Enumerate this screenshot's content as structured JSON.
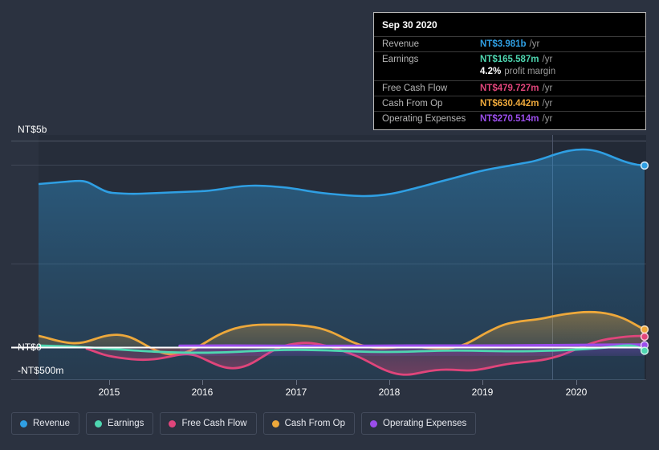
{
  "background_color": "#2b3240",
  "axis": {
    "y_top_label": "NT$5b",
    "y_zero_label": "NT$0",
    "y_bottom_label": "-NT$500m",
    "x_tick_labels": [
      "2015",
      "2016",
      "2017",
      "2018",
      "2019",
      "2020"
    ]
  },
  "tooltip": {
    "date": "Sep 30 2020",
    "rows": [
      {
        "key": "Revenue",
        "value": "NT$3.981b",
        "unit": "/yr",
        "color": "#2f9fe3"
      },
      {
        "key": "Earnings",
        "value": "NT$165.587m",
        "unit": "/yr",
        "color": "#4ed6b0"
      },
      {
        "key": "",
        "value": "4.2%",
        "unit": "profit margin",
        "color": "#ffffff"
      },
      {
        "key": "Free Cash Flow",
        "value": "NT$479.727m",
        "unit": "/yr",
        "color": "#e0457b"
      },
      {
        "key": "Cash From Op",
        "value": "NT$630.442m",
        "unit": "/yr",
        "color": "#eda83b"
      },
      {
        "key": "Operating Expenses",
        "value": "NT$270.514m",
        "unit": "/yr",
        "color": "#9b4deb"
      }
    ]
  },
  "legend": [
    {
      "label": "Revenue",
      "color": "#2f9fe3"
    },
    {
      "label": "Earnings",
      "color": "#4ed6b0"
    },
    {
      "label": "Free Cash Flow",
      "color": "#e0457b"
    },
    {
      "label": "Cash From Op",
      "color": "#eda83b"
    },
    {
      "label": "Operating Expenses",
      "color": "#9b4deb"
    }
  ],
  "chart_data": {
    "type": "line",
    "title": "",
    "xlabel": "",
    "ylabel": "",
    "currency": "NT$",
    "grid": true,
    "legend_position": "bottom",
    "ylim": [
      -500000000,
      5000000000
    ],
    "y_ticks": [
      {
        "label": "NT$5b",
        "value": 5000000000
      },
      {
        "label": "NT$0",
        "value": 0
      },
      {
        "label": "-NT$500m",
        "value": -500000000
      }
    ],
    "x_ticks": [
      "2015",
      "2016",
      "2017",
      "2018",
      "2019",
      "2020"
    ],
    "x_range": [
      "2014-06",
      "2020-12"
    ],
    "forecast_boundary": "2019-11",
    "series": [
      {
        "name": "Revenue",
        "color": "#2f9fe3",
        "filled": true,
        "unit": "NT$",
        "x": [
          "2014-06",
          "2014-09",
          "2014-12",
          "2015-03",
          "2015-06",
          "2015-09",
          "2015-12",
          "2016-03",
          "2016-06",
          "2016-09",
          "2016-12",
          "2017-03",
          "2017-06",
          "2017-09",
          "2017-12",
          "2018-03",
          "2018-06",
          "2018-09",
          "2018-12",
          "2019-03",
          "2019-06",
          "2019-09",
          "2019-12",
          "2020-03",
          "2020-06",
          "2020-09"
        ],
        "values": [
          3.42,
          3.44,
          3.46,
          3.3,
          3.23,
          3.21,
          3.22,
          3.24,
          3.22,
          3.18,
          3.12,
          3.1,
          3.06,
          3.07,
          3.11,
          3.15,
          3.22,
          3.3,
          3.38,
          3.46,
          3.57,
          3.69,
          3.83,
          3.93,
          4.02,
          3.981
        ],
        "value_unit": "billions"
      },
      {
        "name": "Earnings",
        "color": "#4ed6b0",
        "unit": "NT$",
        "x": [
          "2014-06",
          "2014-09",
          "2014-12",
          "2015-03",
          "2015-06",
          "2015-09",
          "2015-12",
          "2016-03",
          "2016-06",
          "2016-09",
          "2016-12",
          "2017-03",
          "2017-06",
          "2017-09",
          "2017-12",
          "2018-03",
          "2018-06",
          "2018-09",
          "2018-12",
          "2019-03",
          "2019-06",
          "2019-09",
          "2019-12",
          "2020-03",
          "2020-06",
          "2020-09"
        ],
        "values": [
          18,
          14,
          10,
          2,
          -8,
          -18,
          -28,
          -38,
          -46,
          -52,
          -50,
          -42,
          -30,
          -18,
          -8,
          -2,
          2,
          0,
          -6,
          -14,
          -18,
          -10,
          10,
          60,
          120,
          165.587
        ],
        "value_unit": "millions"
      },
      {
        "name": "Free Cash Flow",
        "color": "#e0457b",
        "filled": true,
        "unit": "NT$",
        "x": [
          "2014-12",
          "2015-03",
          "2015-06",
          "2015-09",
          "2015-12",
          "2016-03",
          "2016-06",
          "2016-09",
          "2016-12",
          "2017-03",
          "2017-06",
          "2017-09",
          "2017-12",
          "2018-03",
          "2018-06",
          "2018-09",
          "2018-12",
          "2019-03",
          "2019-06",
          "2019-09",
          "2019-12",
          "2020-03",
          "2020-06",
          "2020-09"
        ],
        "values": [
          -30,
          -110,
          -150,
          -140,
          -90,
          -230,
          -300,
          -190,
          -40,
          40,
          10,
          -30,
          -60,
          -120,
          -330,
          -400,
          -310,
          -290,
          -295,
          -250,
          -120,
          180,
          400,
          479.727
        ],
        "value_unit": "millions"
      },
      {
        "name": "Cash From Op",
        "color": "#eda83b",
        "filled": true,
        "unit": "NT$",
        "x": [
          "2014-06",
          "2014-09",
          "2014-12",
          "2015-03",
          "2015-06",
          "2015-09",
          "2015-12",
          "2016-03",
          "2016-06",
          "2016-09",
          "2016-12",
          "2017-03",
          "2017-06",
          "2017-09",
          "2017-12",
          "2018-03",
          "2018-06",
          "2018-09",
          "2018-12",
          "2019-03",
          "2019-06",
          "2019-09",
          "2019-12",
          "2020-03",
          "2020-06",
          "2020-09"
        ],
        "values": [
          130,
          95,
          70,
          90,
          130,
          105,
          30,
          -35,
          -40,
          30,
          130,
          220,
          270,
          280,
          275,
          265,
          200,
          80,
          20,
          -5,
          20,
          15,
          -10,
          180,
          480,
          630.442
        ],
        "value_unit": "millions"
      },
      {
        "name": "Operating Expenses",
        "color": "#9b4deb",
        "unit": "NT$",
        "x": [
          "2015-09",
          "2015-12",
          "2016-03",
          "2016-06",
          "2016-09",
          "2016-12",
          "2017-03",
          "2017-06",
          "2017-09",
          "2017-12",
          "2018-03",
          "2018-06",
          "2018-09",
          "2018-12",
          "2019-03",
          "2019-06",
          "2019-09",
          "2019-12",
          "2020-03",
          "2020-06",
          "2020-09"
        ],
        "values": [
          246,
          248,
          250,
          252,
          254,
          256,
          256,
          255,
          254,
          253,
          252,
          252,
          253,
          254,
          256,
          258,
          260,
          262,
          264,
          268,
          270.514
        ],
        "value_unit": "millions"
      }
    ]
  }
}
